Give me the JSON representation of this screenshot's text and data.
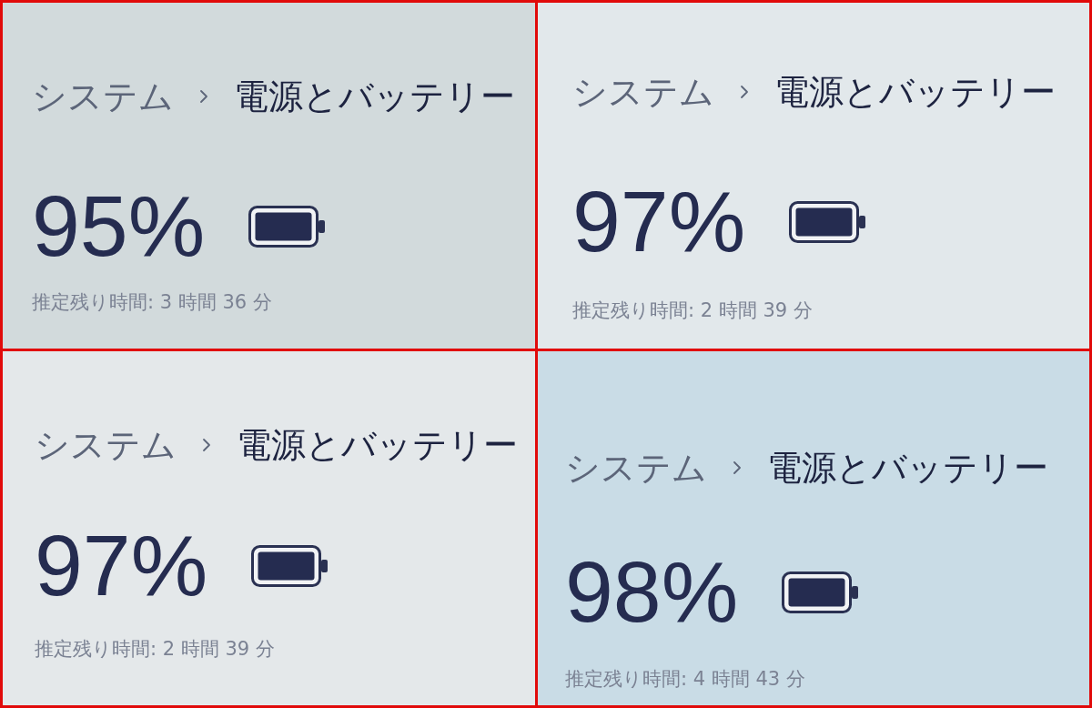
{
  "panels": [
    {
      "breadcrumb": {
        "parent": "システム",
        "current": "電源とバッテリー"
      },
      "percentage": "95%",
      "estimate": "推定残り時間: 3 時間 36 分"
    },
    {
      "breadcrumb": {
        "parent": "システム",
        "current": "電源とバッテリー"
      },
      "percentage": "97%",
      "estimate": "推定残り時間: 2 時間 39 分"
    },
    {
      "breadcrumb": {
        "parent": "システム",
        "current": "電源とバッテリー"
      },
      "percentage": "97%",
      "estimate": "推定残り時間: 2 時間 39 分"
    },
    {
      "breadcrumb": {
        "parent": "システム",
        "current": "電源とバッテリー"
      },
      "percentage": "98%",
      "estimate": "推定残り時間: 4 時間 43 分"
    }
  ]
}
